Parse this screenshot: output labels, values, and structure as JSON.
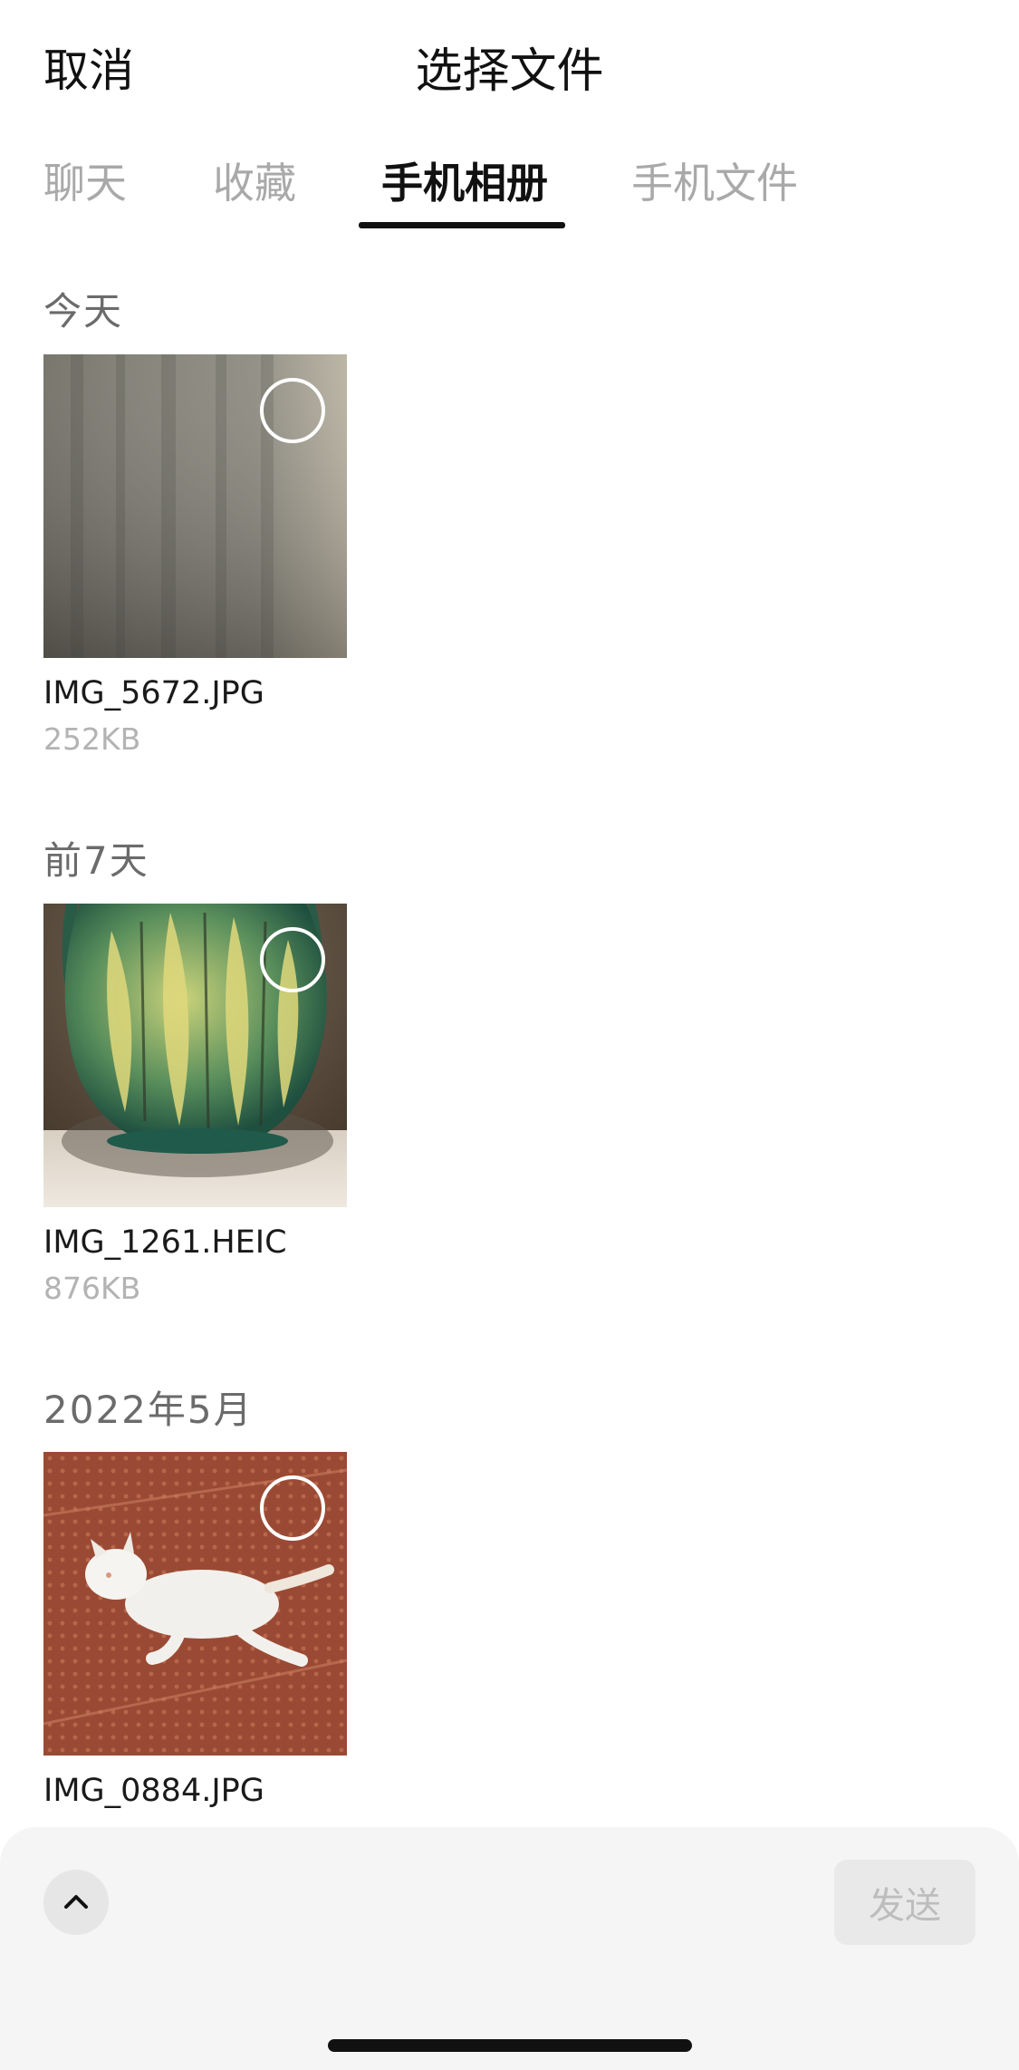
{
  "header": {
    "cancel_label": "取消",
    "title": "选择文件"
  },
  "tabs": [
    {
      "label": "聊天",
      "active": false
    },
    {
      "label": "收藏",
      "active": false
    },
    {
      "label": "手机相册",
      "active": true
    },
    {
      "label": "手机文件",
      "active": false
    }
  ],
  "sections": [
    {
      "label": "今天",
      "files": [
        {
          "name": "IMG_5672.JPG",
          "size": "252KB",
          "thumb_icon": "blurry-gray-photo"
        }
      ]
    },
    {
      "label": "前7天",
      "files": [
        {
          "name": "IMG_1261.HEIC",
          "size": "876KB",
          "thumb_icon": "green-vase-photo"
        }
      ]
    },
    {
      "label": "2022年5月",
      "files": [
        {
          "name": "IMG_0884.JPG",
          "size": "",
          "thumb_icon": "white-cat-photo"
        }
      ]
    }
  ],
  "bottom_bar": {
    "expand_icon": "chevron-up-icon",
    "send_label": "发送"
  },
  "colors": {
    "active_tab": "#111111",
    "inactive_tab": "#a9a9a9",
    "section_label": "#6b6b6b",
    "file_size": "#b3b3b3",
    "bottom_bar_bg": "#f5f5f5",
    "send_disabled_bg": "#e9e9e9"
  }
}
